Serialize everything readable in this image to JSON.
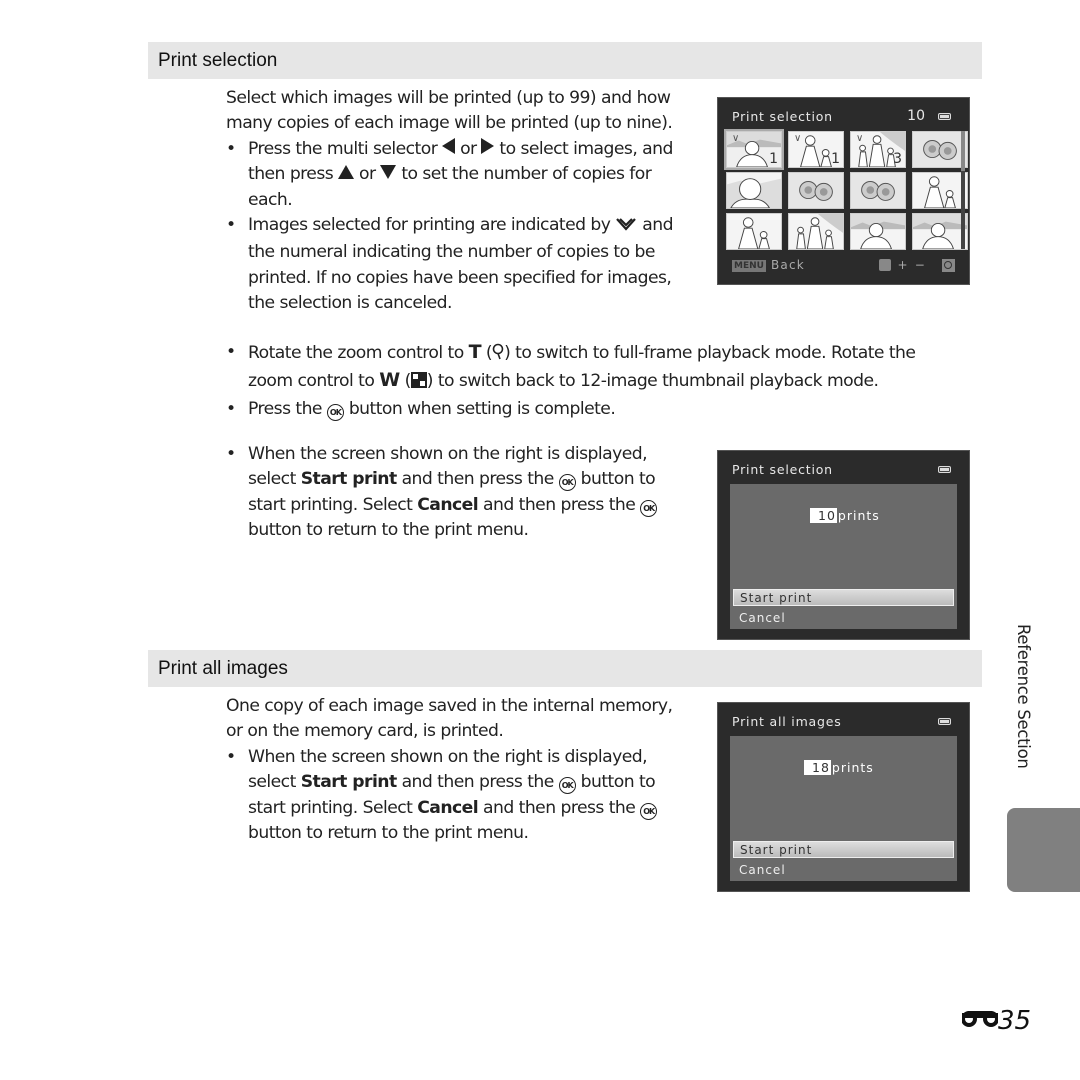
{
  "sections": [
    {
      "header": "Print selection",
      "intro": "Select which images will be printed (up to 99) and how many copies of each image will be printed (up to nine).",
      "bullets": {
        "b1_a": "Press the multi selector",
        "b1_or1": "or",
        "b1_b": "to select images, and then press",
        "b1_or2": "or",
        "b1_c": "to set the number of copies for each.",
        "b2_a": "Images selected for printing are indicated by",
        "b2_b": "and the numeral indicating the number of copies to be printed. If no copies have been specified for images, the selection is canceled.",
        "b3_a": "Rotate the zoom control to",
        "b3_T": "T",
        "b3_b": "to switch to full-frame playback mode. Rotate the zoom control to",
        "b3_W": "W",
        "b3_c": "to switch back to 12-image thumbnail playback mode.",
        "b4_a": "Press the",
        "b4_b": "button when setting is complete.",
        "b5_a": "When the screen shown on the right is displayed, select",
        "b5_start": "Start print",
        "b5_b": "and then press the",
        "b5_c": "button to start printing. Select",
        "b5_cancel": "Cancel",
        "b5_d": "and then press the",
        "b5_e": "button to return to the print menu."
      }
    },
    {
      "header": "Print all images",
      "intro": "One copy of each image saved in the internal memory, or on the memory card, is printed.",
      "bullets": {
        "b1_a": "When the screen shown on the right is displayed, select",
        "b1_start": "Start print",
        "b1_b": "and then press the",
        "b1_c": "button to start printing. Select",
        "b1_cancel": "Cancel",
        "b1_d": "and then press the",
        "b1_e": "button to return to the print menu."
      }
    }
  ],
  "ok_label": "OK",
  "screens": {
    "thumbnail": {
      "title": "Print selection",
      "count": "10",
      "back_badge": "MENU",
      "back_label": "Back",
      "plus": "+",
      "minus": "−",
      "thumbs": [
        {
          "subject": "portrait",
          "selected": true,
          "checked": true,
          "copies": "1"
        },
        {
          "subject": "mother-child",
          "selected": false,
          "checked": true,
          "copies": "1"
        },
        {
          "subject": "family",
          "selected": false,
          "checked": true,
          "copies": "3"
        },
        {
          "subject": "flowers",
          "selected": false,
          "checked": false,
          "copies": ""
        },
        {
          "subject": "face",
          "selected": false,
          "checked": false,
          "copies": ""
        },
        {
          "subject": "flowers",
          "selected": false,
          "checked": false,
          "copies": ""
        },
        {
          "subject": "flowers",
          "selected": false,
          "checked": false,
          "copies": ""
        },
        {
          "subject": "mother-child",
          "selected": false,
          "checked": false,
          "copies": ""
        },
        {
          "subject": "mother-child",
          "selected": false,
          "checked": false,
          "copies": ""
        },
        {
          "subject": "family",
          "selected": false,
          "checked": false,
          "copies": ""
        },
        {
          "subject": "portrait",
          "selected": false,
          "checked": false,
          "copies": ""
        },
        {
          "subject": "portrait",
          "selected": false,
          "checked": false,
          "copies": ""
        }
      ]
    },
    "confirm_selection": {
      "title": "Print selection",
      "prints_count": "10",
      "prints_label": "prints",
      "options": [
        "Start print",
        "Cancel"
      ],
      "selected_option": "Start print"
    },
    "confirm_all": {
      "title": "Print all images",
      "prints_count": "18",
      "prints_label": "prints",
      "options": [
        "Start print",
        "Cancel"
      ],
      "selected_option": "Start print"
    }
  },
  "side_tab": "Reference Section",
  "page_number": "35",
  "page_prefix_icon": "reference-section-icon"
}
